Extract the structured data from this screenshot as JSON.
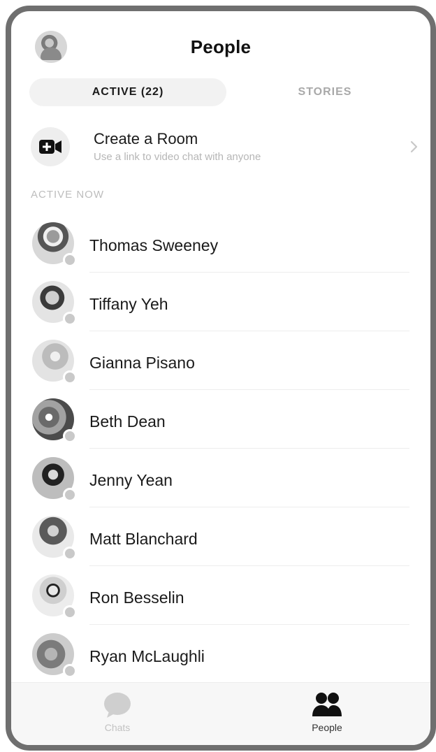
{
  "header": {
    "title": "People"
  },
  "tabs": [
    {
      "label": "ACTIVE (22)",
      "selected": true
    },
    {
      "label": "STORIES",
      "selected": false
    }
  ],
  "create_room": {
    "title": "Create a Room",
    "subtitle": "Use a link to video chat with anyone",
    "icon": "video-camera-plus-icon"
  },
  "section": {
    "label": "ACTIVE NOW"
  },
  "people": [
    {
      "name": "Thomas Sweeney"
    },
    {
      "name": "Tiffany Yeh"
    },
    {
      "name": "Gianna Pisano"
    },
    {
      "name": "Beth Dean"
    },
    {
      "name": "Jenny Yean"
    },
    {
      "name": "Matt Blanchard"
    },
    {
      "name": "Ron Besselin"
    },
    {
      "name": "Ryan McLaughli"
    }
  ],
  "bottom_nav": {
    "chats_label": "Chats",
    "people_label": "People"
  }
}
